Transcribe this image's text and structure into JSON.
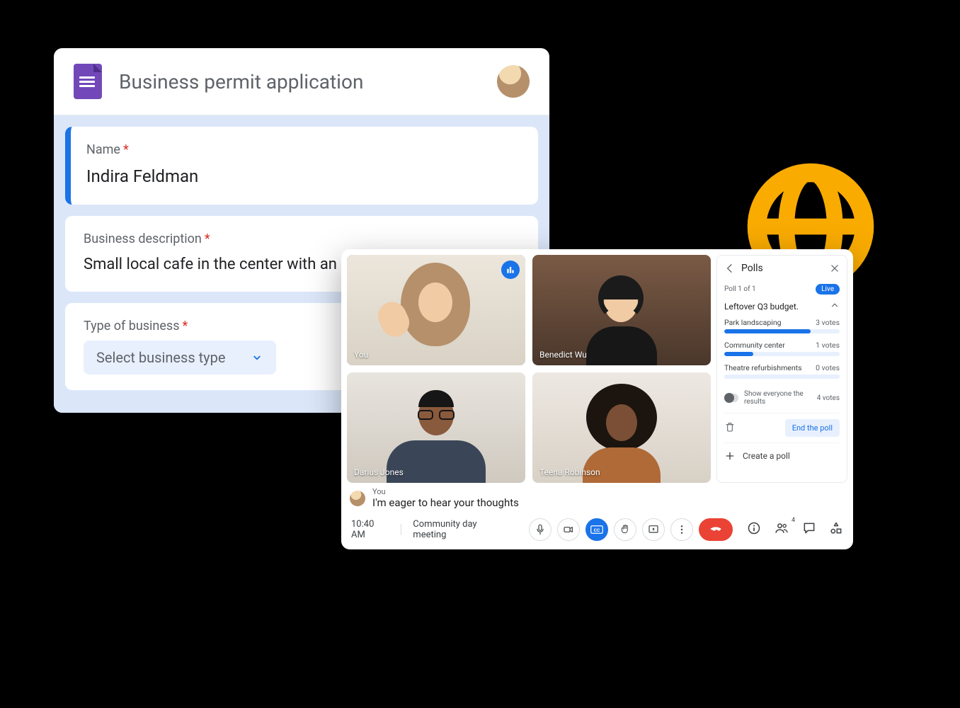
{
  "form": {
    "title": "Business permit application",
    "questions": {
      "name": {
        "label": "Name",
        "value": "Indira Feldman",
        "required": true
      },
      "description": {
        "label": "Business description",
        "value": "Small local cafe in the center with an onsite bakery.",
        "required": true
      },
      "type": {
        "label": "Type of business",
        "placeholder": "Select business type",
        "required": true
      }
    }
  },
  "meet": {
    "time": "10:40 AM",
    "meeting_name": "Community day meeting",
    "participants": {
      "p0": "You",
      "p1": "Benedict Wu",
      "p2": "Darius Jones",
      "p3": "Teena Robinson"
    },
    "caption": {
      "speaker": "You",
      "text": "I'm eager to hear your thoughts"
    },
    "people_count": "4",
    "polls": {
      "title": "Polls",
      "counter": "Poll 1 of 1",
      "live_label": "Live",
      "question": "Leftover Q3 budget.",
      "options": {
        "o0": {
          "label": "Park landscaping",
          "votes": "3 votes",
          "pct": 75
        },
        "o1": {
          "label": "Community center",
          "votes": "1 votes",
          "pct": 25
        },
        "o2": {
          "label": "Theatre refurbishments",
          "votes": "0 votes",
          "pct": 0
        }
      },
      "show_results_label": "Show everyone the results",
      "total_votes": "4 votes",
      "end_label": "End the poll",
      "create_label": "Create a poll"
    }
  },
  "colors": {
    "accent": "#1a73e8",
    "globe": "#f9ab00",
    "form_purple": "#7248b9",
    "danger": "#ea4335"
  }
}
